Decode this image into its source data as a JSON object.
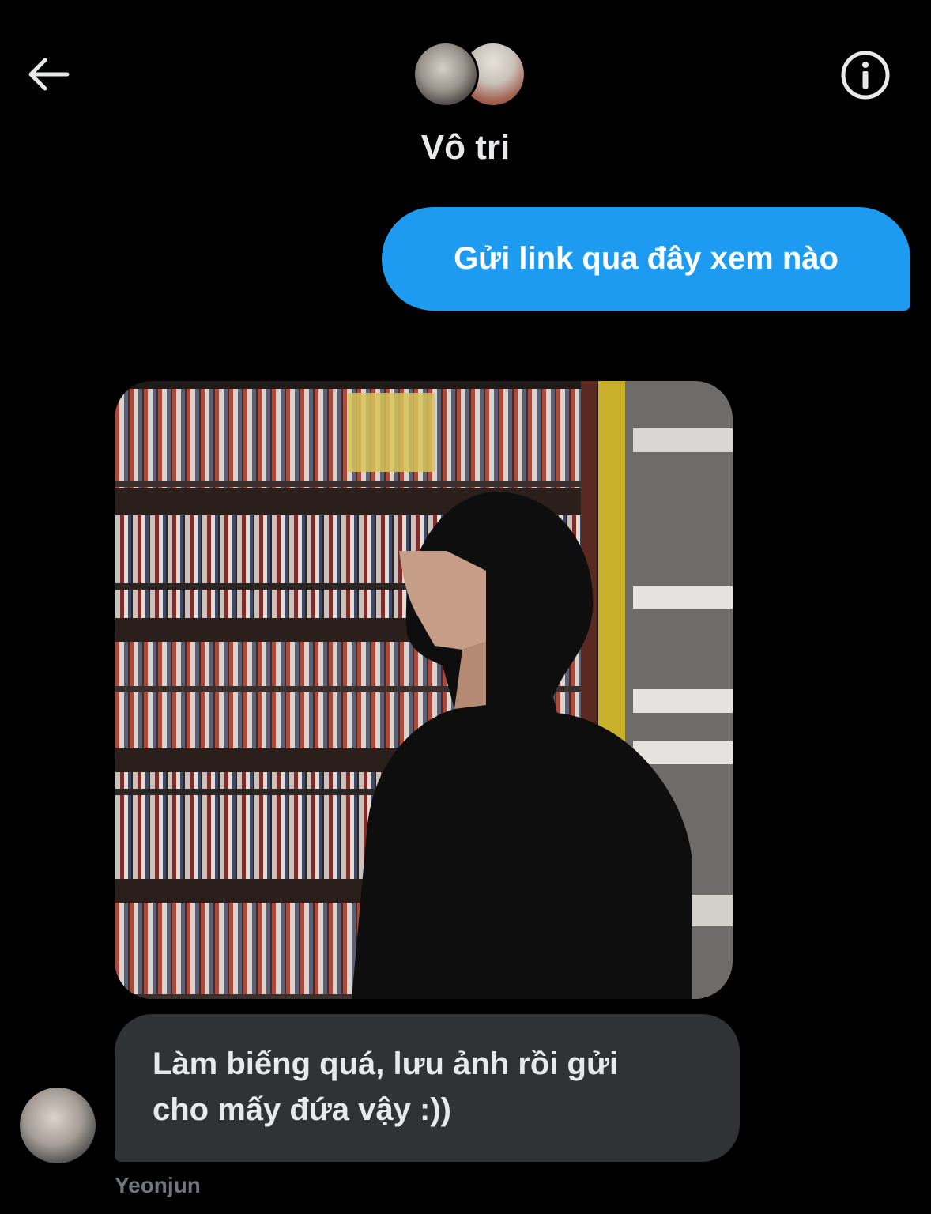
{
  "header": {
    "title": "Vô tri",
    "back_icon": "arrow-left-icon",
    "info_icon": "info-circle-icon"
  },
  "messages": {
    "outgoing": {
      "text": "Gửi link qua đây xem nào"
    },
    "incoming_photo": {
      "description_icon": "photo-image"
    },
    "incoming_text": {
      "line1": "Làm biếng quá, lưu ảnh rồi gửi",
      "line2": "cho mấy đứa vậy :))"
    },
    "sender": {
      "name": "Yeonjun"
    }
  },
  "colors": {
    "background": "#000000",
    "outgoing_bubble": "#1d9bf0",
    "incoming_bubble": "#2f3336",
    "text_primary": "#e7e9ea",
    "text_secondary": "#71767b"
  }
}
